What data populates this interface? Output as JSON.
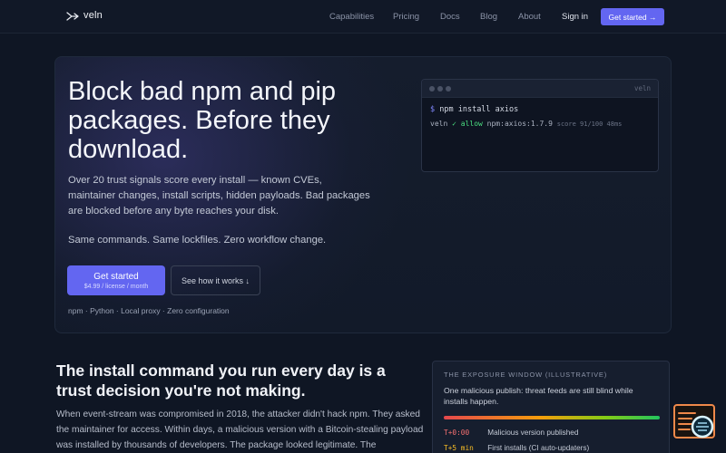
{
  "nav": {
    "logo_text": "veln",
    "logo_icon": "arrow-fork-icon",
    "links": [
      "Capabilities",
      "Pricing",
      "Docs",
      "Blog",
      "About"
    ],
    "signin": "Sign in",
    "cta": "Get started →"
  },
  "hero": {
    "title": "Block bad npm and pip packages. Before they download.",
    "description": "Over 20 trust signals score every install — known CVEs, maintainer changes, install scripts, hidden payloads. Bad packages are blocked before any byte reaches your disk.",
    "tagline": "Same commands. Same lockfiles. Zero workflow change.",
    "primary_button": {
      "label": "Get started",
      "sub": "$4.99 / license / month"
    },
    "secondary_button": "See how it works ↓",
    "meta": "npm · Python · Local proxy · Zero configuration"
  },
  "terminal": {
    "title": "veln",
    "prompt": "$",
    "command": "npm install axios",
    "result_prefix": "veln",
    "result_check": "✓",
    "result_status": "allow",
    "result_package": "npm:axios:1.7.9",
    "result_meta": "score 91/100 48ms"
  },
  "section": {
    "title": "The install command you run every day is a trust decision you're not making.",
    "body": "When event-stream was compromised in 2018, the attacker didn't hack npm. They asked the maintainer for access. Within days, a malicious version with a Bitcoin-stealing payload was installed by thousands of developers. The package looked legitimate. The maintainer's"
  },
  "exposure": {
    "label": "THE EXPOSURE WINDOW (ILLUSTRATIVE)",
    "text": "One malicious publish: threat feeds are still blind while installs happen.",
    "rows": [
      {
        "time": "T+0:00",
        "desc": "Malicious version published",
        "color": "#f87171"
      },
      {
        "time": "T+5 min",
        "desc": "First installs (CI auto-updaters)",
        "color": "#fbbf24"
      }
    ]
  },
  "colors": {
    "accent": "#6366f1",
    "background": "#0f1624",
    "allow": "#4ade80"
  },
  "widget_icon": "chat-assistant-icon"
}
